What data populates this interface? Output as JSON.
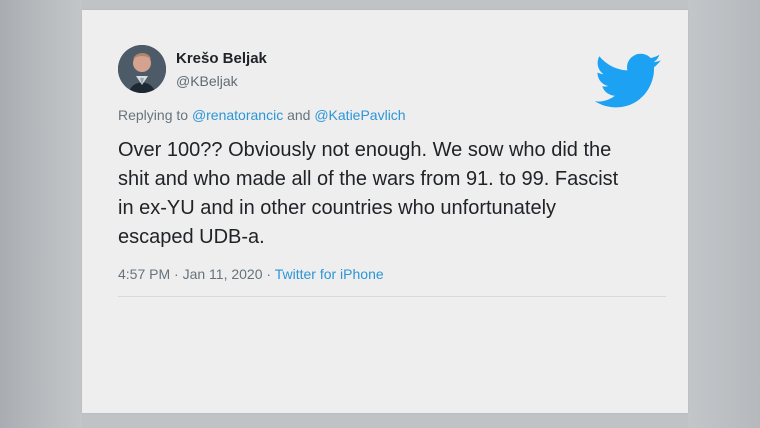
{
  "tweet": {
    "author_name": "Krešo Beljak",
    "author_handle": "@KBeljak",
    "replying_to_prefix": "Replying to",
    "reply_mention_1": "@renatorancic",
    "reply_and": "and",
    "reply_mention_2": "@KatiePavlich",
    "body_lines": [
      "Over 100?? Obviously not enough. We sow who did the",
      "shit and who made all of the wars from 91. to 99. Fascist",
      "in ex-YU and in other countries who unfortunately",
      "escaped UDB-a."
    ],
    "timestamp": "4:57 PM · Jan 11, 2020 ·",
    "source": "Twitter for iPhone"
  },
  "icons": {
    "brand": "twitter-bird-icon",
    "avatar": "profile-avatar"
  },
  "colors": {
    "brand": "#1da1f2",
    "link": "#2c95d8",
    "text": "#202327",
    "muted": "#66737b",
    "card_background": "#eeeeee"
  }
}
